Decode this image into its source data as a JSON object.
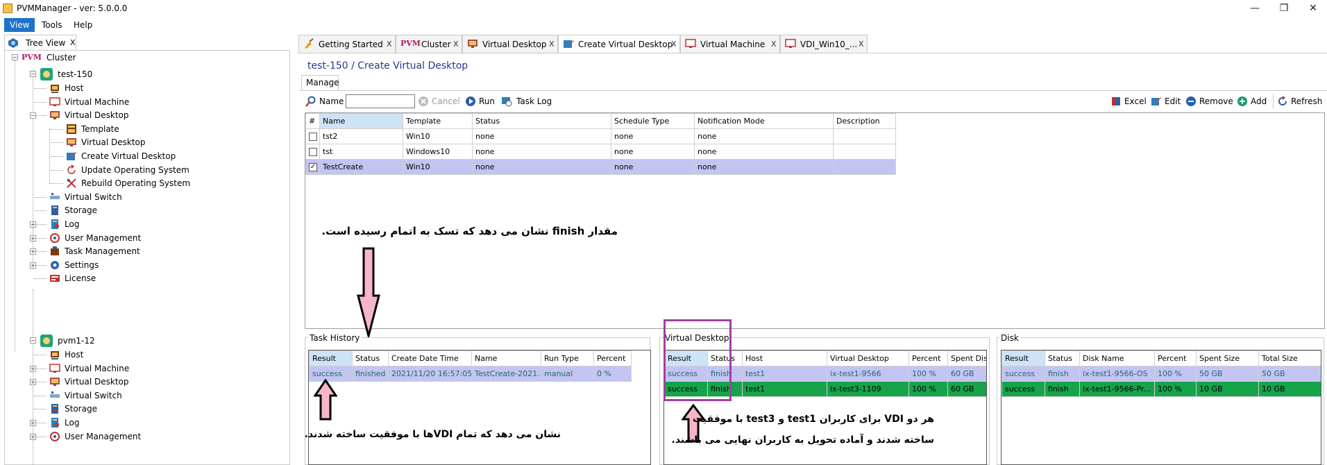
{
  "window": {
    "title": "PVMManager - ver: 5.0.0.0",
    "minimize": "—",
    "restore": "❐",
    "close": "✕"
  },
  "menu": [
    "View",
    "Tools",
    "Help"
  ],
  "tree_tab": {
    "label": "Tree View",
    "close": "X"
  },
  "tree": {
    "root": "Cluster",
    "pvm_logo": "PVM",
    "host1": "test-150",
    "host1_items": [
      "Host",
      "Virtual Machine",
      "Virtual Desktop",
      "Template",
      "Virtual Desktop",
      "Create Virtual Desktop",
      "Update Operating System",
      "Rebuild Operating System",
      "Virtual Switch",
      "Storage",
      "Log",
      "User Management",
      "Task Management",
      "Settings",
      "License"
    ],
    "host2": "pvm1-12",
    "host2_items": [
      "Host",
      "Virtual Machine",
      "Virtual Desktop",
      "Virtual Switch",
      "Storage",
      "Log",
      "User Management"
    ]
  },
  "tabs": [
    {
      "label": "Getting Started",
      "close": "X"
    },
    {
      "label": "Cluster",
      "close": "X"
    },
    {
      "label": "Virtual Desktop",
      "close": "X"
    },
    {
      "label": "Create Virtual Desktop",
      "close": "X"
    },
    {
      "label": "Virtual Machine",
      "close": "X"
    },
    {
      "label": "VDI_Win10_...",
      "close": "X"
    }
  ],
  "breadcrumb": "test-150 / Create Virtual Desktop",
  "manage_tab": "Manage",
  "toolbar": {
    "name_label": "Name",
    "name_value": "",
    "cancel": "Cancel",
    "run": "Run",
    "task_log": "Task Log",
    "excel": "Excel",
    "edit": "Edit",
    "remove": "Remove",
    "add": "Add",
    "refresh": "Refresh"
  },
  "vd_grid": {
    "columns": [
      "#",
      "Name",
      "Template",
      "Status",
      "Schedule Type",
      "Notification Mode",
      "Description"
    ],
    "rows": [
      {
        "checked": false,
        "name": "tst2",
        "template": "Win10",
        "status": "none",
        "schedule": "none",
        "notify": "none",
        "desc": ""
      },
      {
        "checked": false,
        "name": "tst",
        "template": "Windows10",
        "status": "none",
        "schedule": "none",
        "notify": "none",
        "desc": ""
      },
      {
        "checked": true,
        "name": "TestCreate",
        "template": "Win10",
        "status": "none",
        "schedule": "none",
        "notify": "none",
        "desc": ""
      }
    ]
  },
  "task_history": {
    "title": "Task History",
    "columns": [
      "Result",
      "Status",
      "Create Date Time",
      "Name",
      "Run Type",
      "Percent"
    ],
    "rows": [
      [
        "success",
        "finished",
        "2021/11/20 16:57:05",
        "TestCreate-2021...",
        "manual",
        "0 %"
      ]
    ]
  },
  "virtual_desktop_panel": {
    "title": "Virtual Desktop",
    "columns": [
      "Result",
      "Status",
      "Host",
      "Virtual Desktop",
      "Percent",
      "Spent Disks"
    ],
    "rows": [
      [
        "success",
        "finish",
        "test1",
        "ix-test1-9566",
        "100 %",
        "60 GB"
      ],
      [
        "success",
        "finish",
        "test1",
        "ix-test3-1109",
        "100 %",
        "60 GB"
      ]
    ]
  },
  "disk_panel": {
    "title": "Disk",
    "columns": [
      "Result",
      "Status",
      "Disk Name",
      "Percent",
      "Spent Size",
      "Total Size"
    ],
    "rows": [
      [
        "success",
        "finish",
        "ix-test1-9566-OS",
        "100 %",
        "50 GB",
        "50 GB"
      ],
      [
        "success",
        "finish",
        "ix-test1-9566-Pr...",
        "100 %",
        "10 GB",
        "10 GB"
      ]
    ]
  },
  "annotations": {
    "finish_note": "مقدار finish نشان می دهد که تسک به اتمام رسیده است.",
    "success_note": "نشان می دهد که تمام VDIها با موفقیت ساخته شدند.",
    "users_note_line1": "هر دو VDI برای کاربران test1 و test3 با موفقیت",
    "users_note_line2": "ساخته شدند و آماده تحویل به کاربران نهایی می باشند."
  },
  "colors": {
    "accent": "#1e72c8",
    "selected_row": "#c4c4f2",
    "success_row": "#16a34a",
    "highlight_box": "#a040a0",
    "arrow_fill": "#f7b6c8"
  }
}
